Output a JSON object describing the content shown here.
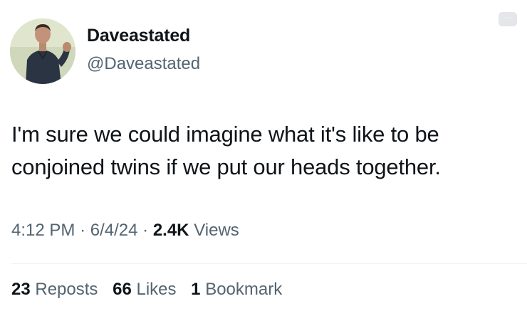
{
  "author": {
    "display_name": "Daveastated",
    "handle": "@Daveastated",
    "avatar_icon": "user-avatar-photo"
  },
  "more_button": {
    "icon": "ellipsis-icon",
    "label": "···"
  },
  "tweet": {
    "text_line1": "I'm sure we could imagine what it's like to be",
    "text_line2": "conjoined twins if we put our heads together."
  },
  "meta": {
    "time": "4:12 PM",
    "separator": "·",
    "date": "6/4/24",
    "views_count": "2.4K",
    "views_label": "Views"
  },
  "stats": {
    "reposts_count": "23",
    "reposts_label": "Reposts",
    "likes_count": "66",
    "likes_label": "Likes",
    "bookmarks_count": "1",
    "bookmarks_label": "Bookmark"
  },
  "colors": {
    "text_primary": "#0f1419",
    "text_secondary": "#536471",
    "divider": "#eff3f4"
  }
}
